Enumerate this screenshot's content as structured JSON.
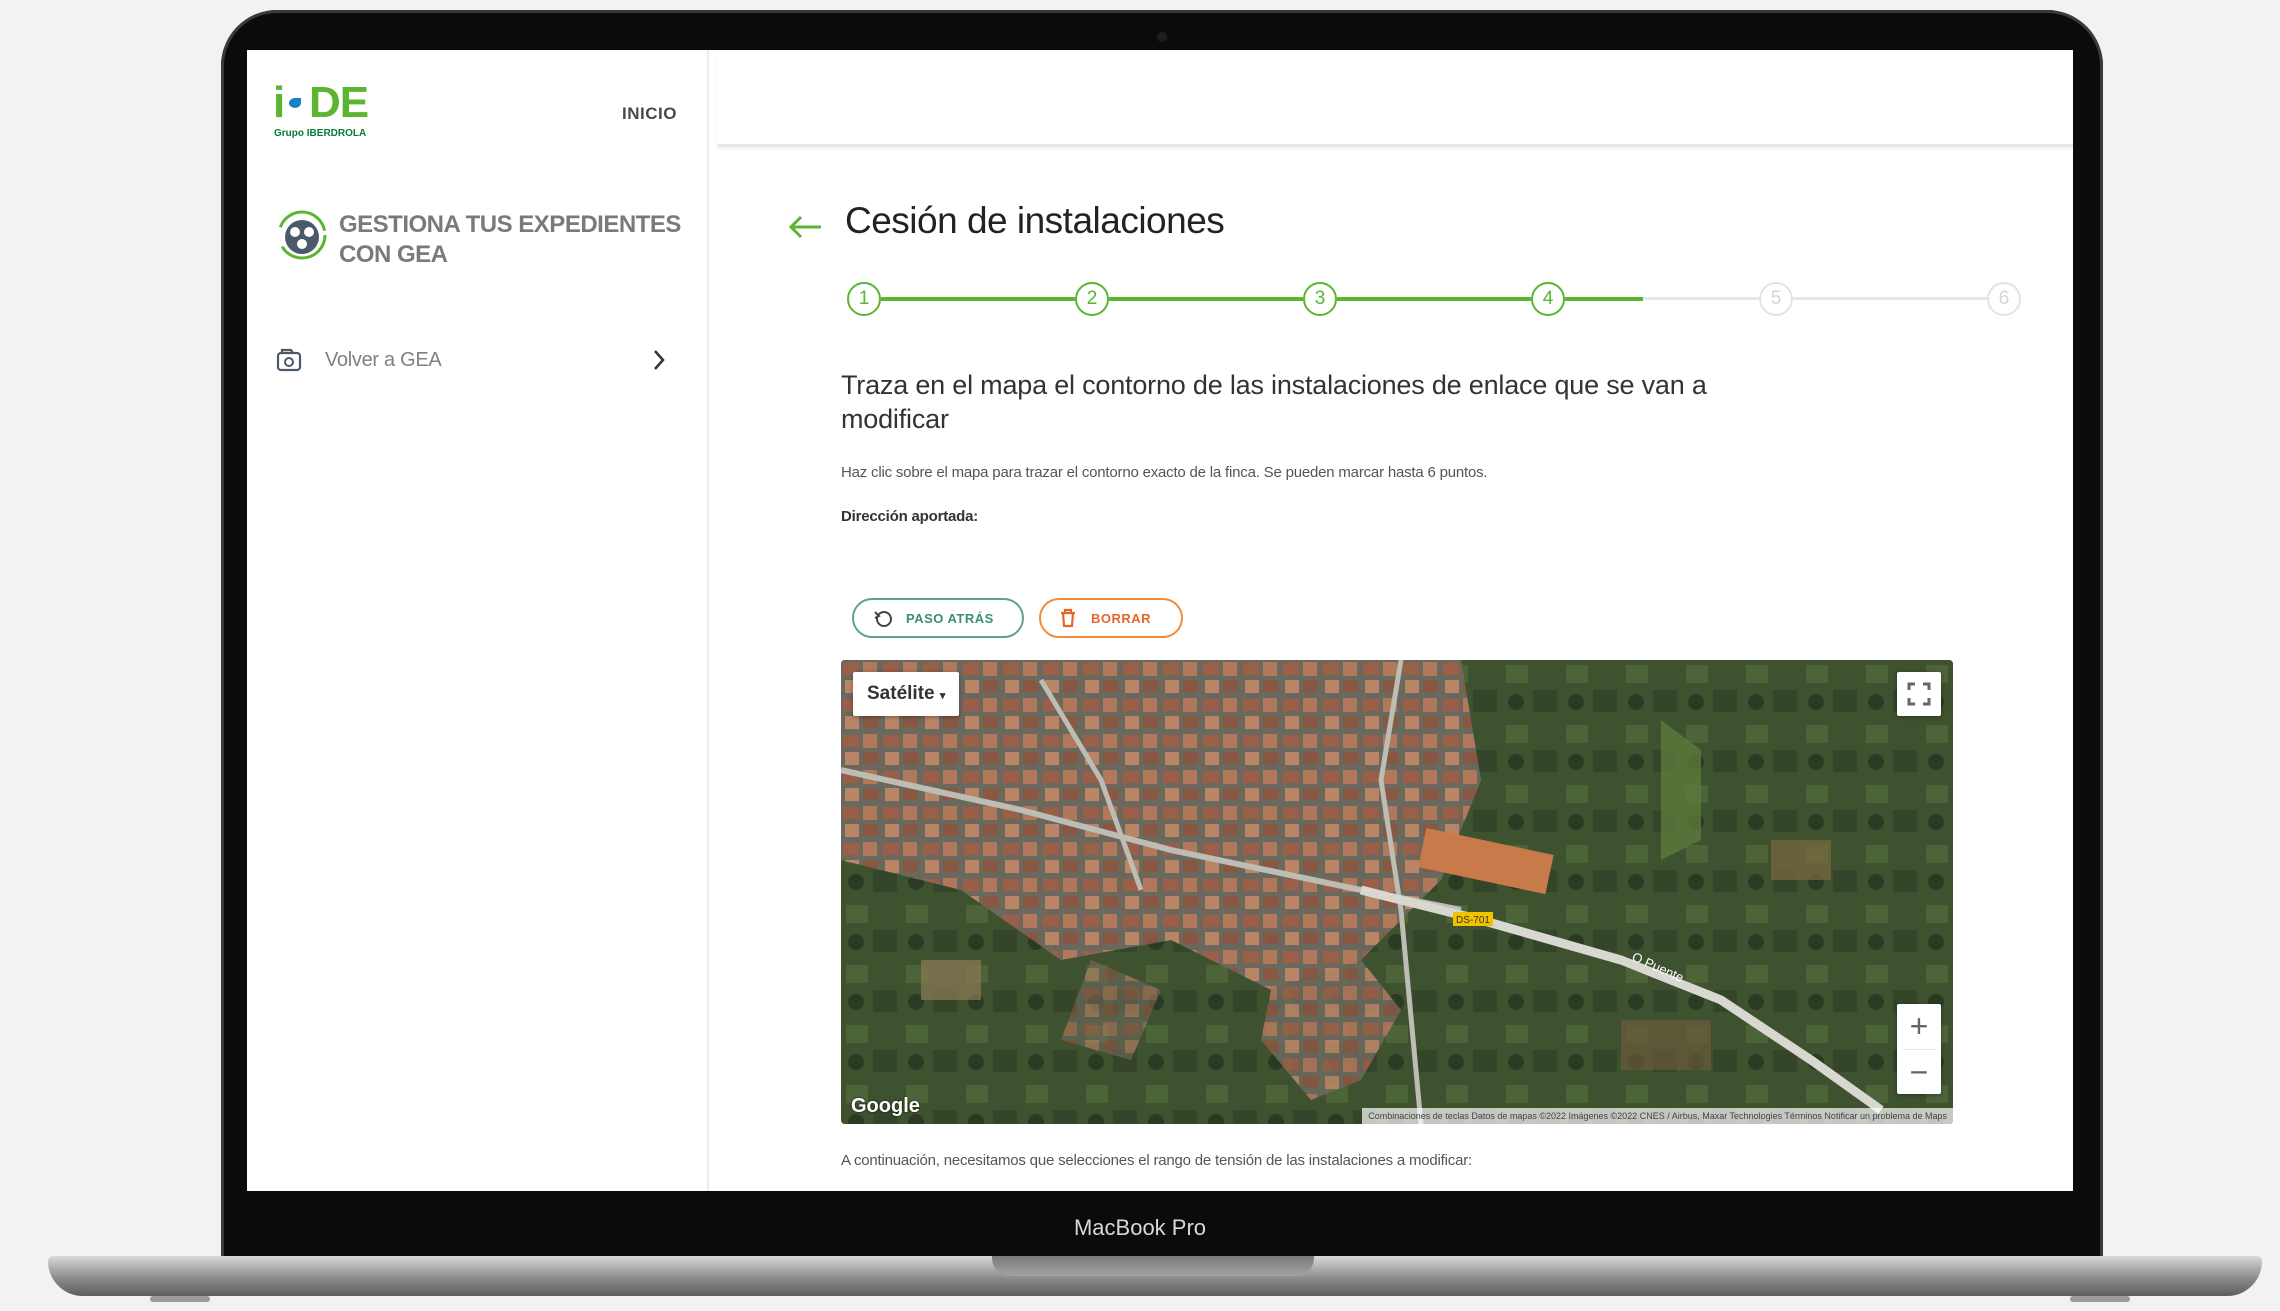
{
  "device": {
    "label": "MacBook Pro"
  },
  "brand": {
    "logo_main": "i-DE",
    "logo_sub": "Grupo IBERDROLA"
  },
  "header": {
    "inicio": "INICIO"
  },
  "sidebar": {
    "title": "GESTIONA TUS EXPEDIENTES CON GEA",
    "back_link": "Volver a GEA"
  },
  "page": {
    "title": "Cesión de instalaciones"
  },
  "stepper": {
    "steps": [
      "1",
      "2",
      "3",
      "4",
      "5",
      "6"
    ],
    "current_step": 4,
    "progress_after_current": 0.4
  },
  "content": {
    "heading": "Traza en el mapa el contorno de las instalaciones de enlace que se van a modificar",
    "hint": "Haz clic sobre el mapa para trazar el contorno exacto de la finca. Se pueden marcar hasta 6 puntos.",
    "address_label": "Dirección aportada:",
    "footer": "A continuación, necesitamos que selecciones el rango de tensión de las instalaciones a modificar:"
  },
  "buttons": {
    "step_back": "PASO ATRÁS",
    "delete": "BORRAR"
  },
  "map": {
    "type_selector": "Satélite",
    "zoom_in": "+",
    "zoom_out": "−",
    "provider": "Google",
    "attribution": "Combinaciones de teclas   Datos de mapas ©2022 Imágenes ©2022 CNES / Airbus, Maxar Technologies   Términos   Notificar un problema de Maps",
    "road_labels": [
      "DS-701",
      "O Puente"
    ]
  },
  "colors": {
    "brand_green": "#5bb531",
    "step_back_teal": "#3b8f6e",
    "delete_orange": "#e8652a"
  }
}
